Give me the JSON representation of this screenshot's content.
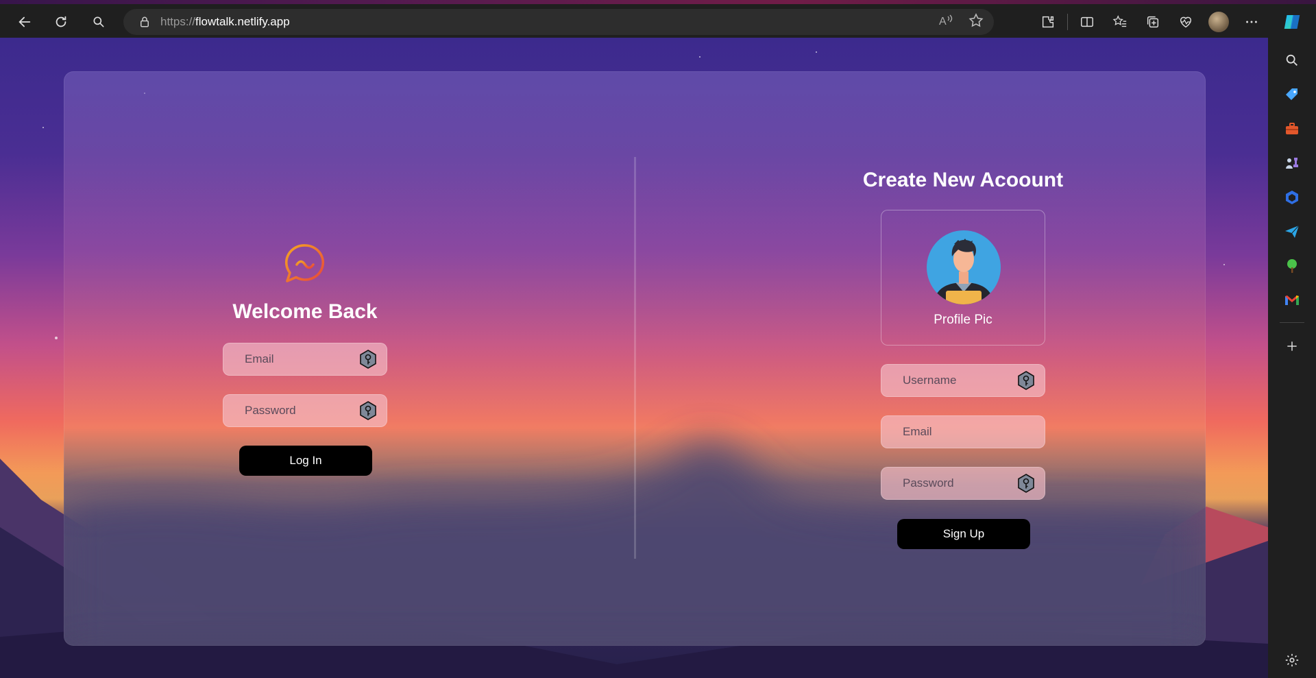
{
  "browser": {
    "url_scheme": "https://",
    "url_host": "flowtalk.netlify.app",
    "icons": [
      "back-icon",
      "refresh-icon",
      "search-icon",
      "lock-icon",
      "read-aloud-icon",
      "favorite-star-icon",
      "extensions-icon",
      "split-screen-icon",
      "favorites-icon",
      "collections-icon",
      "browser-essentials-icon",
      "profile-avatar",
      "more-icon",
      "copilot-icon"
    ]
  },
  "sidebar": {
    "icons": [
      "search-icon",
      "shopping-tag-icon",
      "tools-icon",
      "games-icon",
      "microsoft365-icon",
      "send-icon",
      "tree-icon",
      "gmail-icon",
      "add-icon",
      "settings-icon"
    ]
  },
  "login": {
    "title": "Welcome Back",
    "email_placeholder": "Email",
    "password_placeholder": "Password",
    "button": "Log In"
  },
  "signup": {
    "title": "Create New Acoount",
    "profile_pic_label": "Profile Pic",
    "username_placeholder": "Username",
    "email_placeholder": "Email",
    "password_placeholder": "Password",
    "button": "Sign Up"
  },
  "colors": {
    "button_bg": "#000000",
    "field_bg": "#f5bec8",
    "title_text": "#ffffff",
    "logo_gradient_start": "#f5a623",
    "logo_gradient_end": "#e8463a"
  }
}
